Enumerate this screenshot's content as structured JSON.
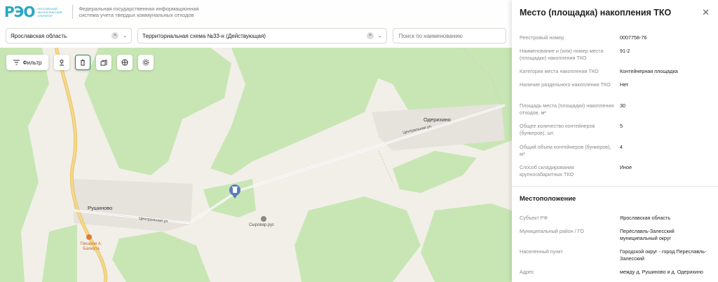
{
  "header": {
    "logo_text": "РЭО",
    "logo_sub": "Российский экологический оператор",
    "logo_tag": "ФГИС",
    "system_title": "Федеральная государственная информационная система учета твердых коммунальных отходов"
  },
  "filters": {
    "region": "Ярославская область",
    "scheme": "Территориальная схема №33-н (Действующая)",
    "search_placeholder": "Поиск по наименованию",
    "clear_glyph": "×",
    "chevron_glyph": "⌄"
  },
  "toolbar": {
    "filter_label": "Фильтр"
  },
  "map": {
    "villages": [
      "Одерихино",
      "Рушиново"
    ],
    "streets": [
      "Центральная ул.",
      "Центральная ул."
    ],
    "poi": [
      {
        "name": "Сыровар.рус",
        "color": "#555555"
      },
      {
        "name": "Пекарня А. Бахмута",
        "color": "#c86a2c"
      }
    ],
    "marker_icon": "trash-bin-icon"
  },
  "panel": {
    "title": "Место (площадка) накопления ТКО",
    "close_glyph": "✕",
    "details": [
      {
        "k": "Реестровый номер",
        "v": "0007758-76"
      },
      {
        "k": "Наименование и (или) номер места (площадки) накопления ТКО",
        "v": "91-2"
      },
      {
        "k": "Категория места накопления ТКО",
        "v": "Контейнерная площадка"
      },
      {
        "k": "Наличие раздельного накопления ТКО",
        "v": "Нет"
      },
      {
        "k": "Площадь места (площадки) накопления отходов, м²",
        "v": "30"
      },
      {
        "k": "Общее количество контейнеров (бункеров), шт.",
        "v": "5"
      },
      {
        "k": "Общий объем контейнеров (бункеров), м³",
        "v": "4"
      },
      {
        "k": "Способ складирования крупногабаритных ТКО",
        "v": "Иное"
      }
    ],
    "location_title": "Местоположение",
    "location": [
      {
        "k": "Субъект РФ",
        "v": "Ярославская область"
      },
      {
        "k": "Муниципальный район / ГО",
        "v": "Переславль-Залесский муниципальный округ"
      },
      {
        "k": "Населенный пункт",
        "v": "Городской округ - город Переславль-Залесский"
      },
      {
        "k": "Адрес",
        "v": "между д. Рушиново и д. Одерихино"
      }
    ]
  },
  "colors": {
    "forest": "#c8e6b4",
    "field": "#f2efe9",
    "road_main": "#f5d98a",
    "accent": "#2e8b57",
    "brand": "#27a7c4"
  }
}
